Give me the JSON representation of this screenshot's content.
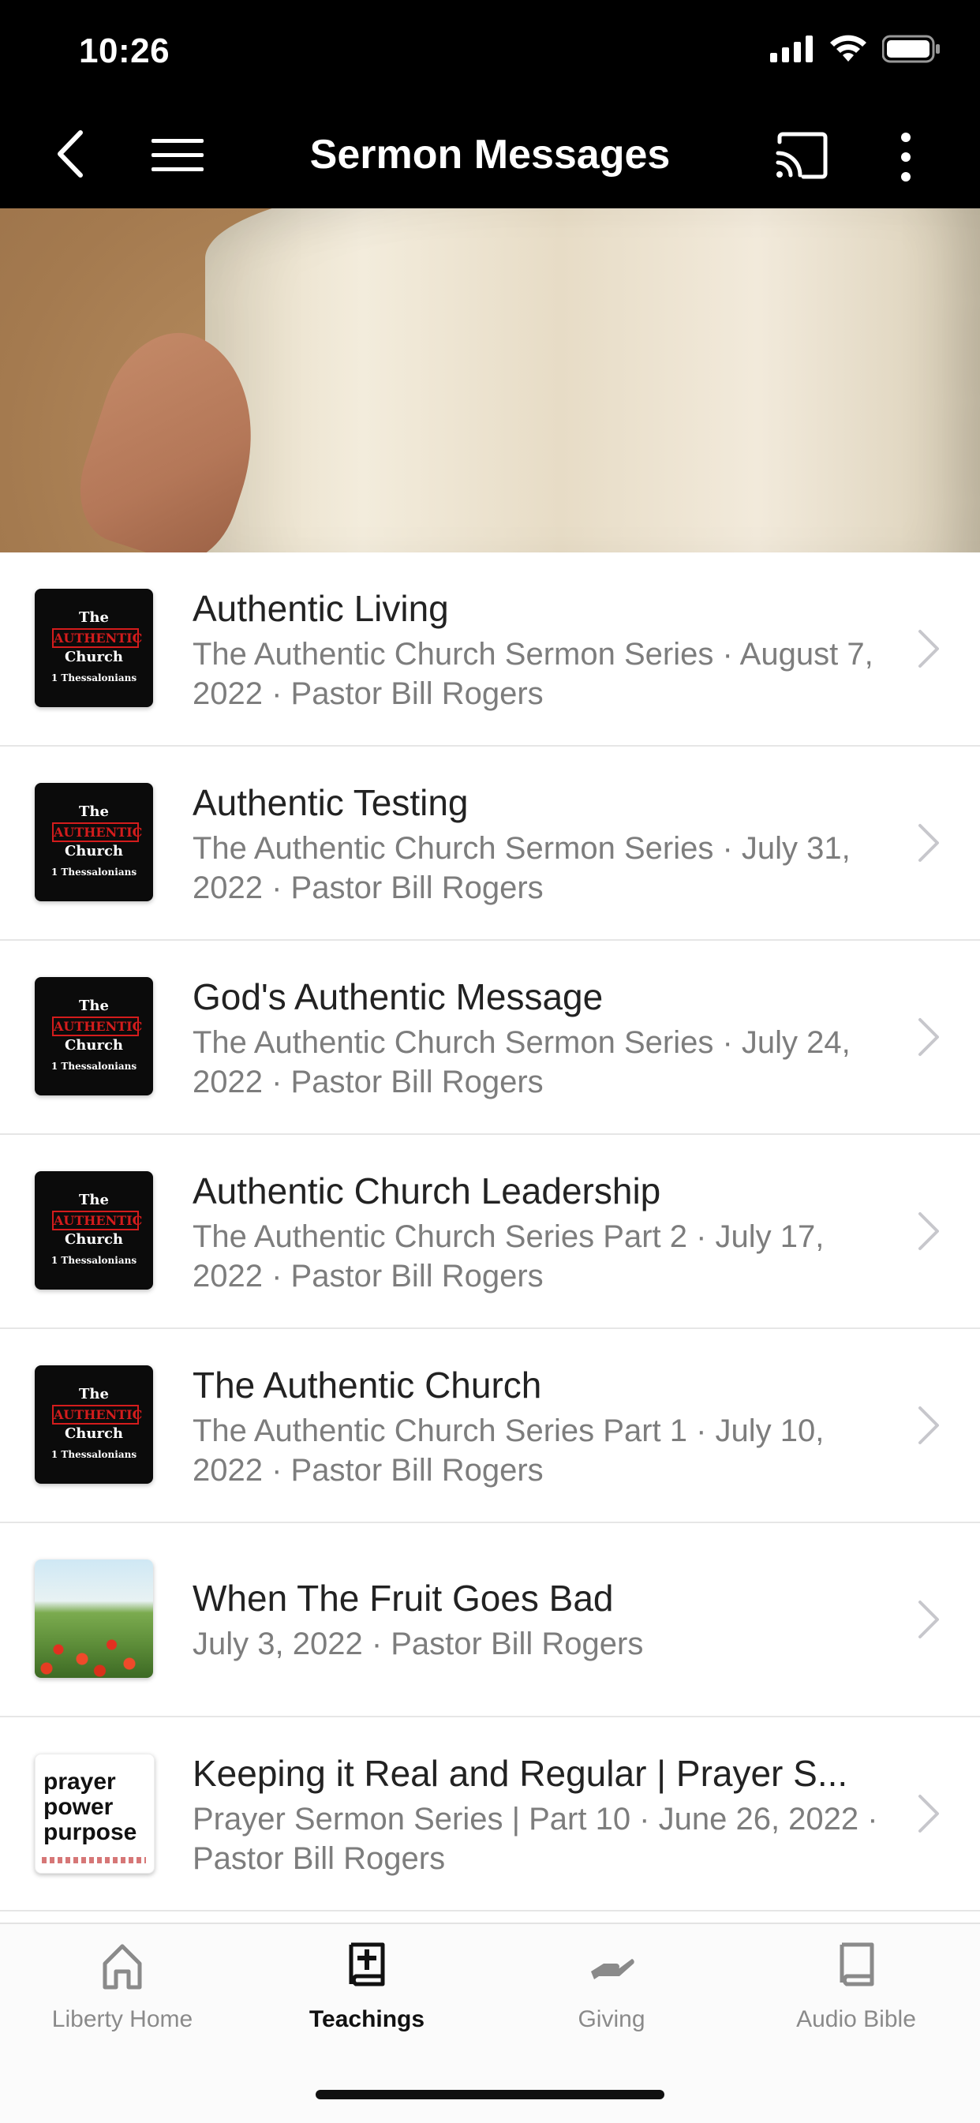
{
  "status": {
    "time": "10:26"
  },
  "nav": {
    "title": "Sermon Messages"
  },
  "sermons": [
    {
      "title": "Authentic Living",
      "subtitle": "The Authentic Church Sermon Series · August 7, 2022 · Pastor Bill Rogers",
      "thumb": "authentic"
    },
    {
      "title": "Authentic Testing",
      "subtitle": "The Authentic Church Sermon Series · July 31, 2022 · Pastor Bill Rogers",
      "thumb": "authentic"
    },
    {
      "title": "God's Authentic Message",
      "subtitle": "The Authentic Church Sermon Series · July 24, 2022 · Pastor Bill Rogers",
      "thumb": "authentic"
    },
    {
      "title": "Authentic Church Leadership",
      "subtitle": "The Authentic Church Series Part 2 · July 17, 2022 · Pastor Bill Rogers",
      "thumb": "authentic"
    },
    {
      "title": "The Authentic Church",
      "subtitle": "The Authentic Church Series Part 1 · July 10, 2022 · Pastor Bill Rogers",
      "thumb": "authentic"
    },
    {
      "title": "When The Fruit Goes Bad",
      "subtitle": "July 3, 2022 · Pastor Bill Rogers",
      "thumb": "vineyard"
    },
    {
      "title": "Keeping it Real and Regular | Prayer S...",
      "subtitle": "Prayer Sermon Series | Part 10 · June 26, 2022 · Pastor Bill Rogers",
      "thumb": "prayer"
    }
  ],
  "thumb_authentic": {
    "line1": "The",
    "line2": "AUTHENTIC",
    "line3": "Church",
    "line4": "1 Thessalonians"
  },
  "thumb_prayer": {
    "line1": "prayer",
    "line2": "power",
    "line3": "purpose"
  },
  "tabs": [
    {
      "label": "Liberty Home",
      "icon": "home-icon",
      "active": false
    },
    {
      "label": "Teachings",
      "icon": "bible-plus-icon",
      "active": true
    },
    {
      "label": "Giving",
      "icon": "giving-hand-icon",
      "active": false
    },
    {
      "label": "Audio Bible",
      "icon": "book-icon",
      "active": false
    }
  ],
  "colors": {
    "accent_red": "#d41c1c",
    "nav_bg": "#000000",
    "subtitle_gray": "#7d7d7d"
  }
}
